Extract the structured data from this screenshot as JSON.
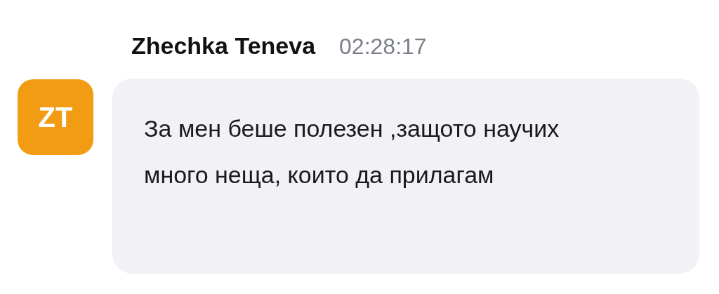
{
  "message": {
    "author": "Zhechka Teneva",
    "time": "02:28:17",
    "avatar": {
      "initials": "ZT",
      "color": "#f29c14"
    },
    "text": "За мен беше полезен ,защото научих много неща, които да прилагам"
  }
}
